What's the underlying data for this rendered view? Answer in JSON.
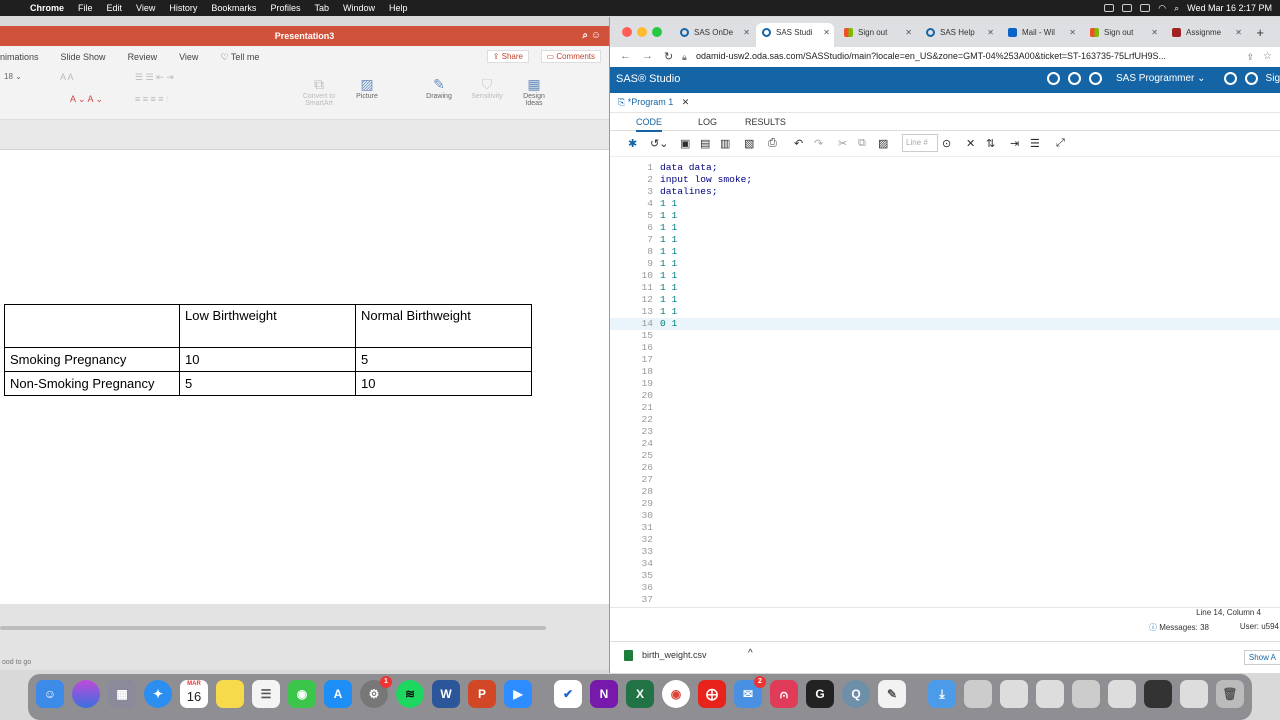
{
  "menubar": {
    "items": [
      "Chrome",
      "File",
      "Edit",
      "View",
      "History",
      "Bookmarks",
      "Profiles",
      "Tab",
      "Window",
      "Help"
    ],
    "clock": "Wed Mar 16  2:17 PM"
  },
  "ppt": {
    "title": "Presentation3",
    "tabs": [
      "nimations",
      "Slide Show",
      "Review",
      "View",
      "Tell me"
    ],
    "share_label": "Share",
    "comments_label": "Comments",
    "font_size": "18",
    "ribbon": {
      "convert": "Convert to SmartArt",
      "picture": "Picture",
      "drawing": "Drawing",
      "sensitivity": "Sensitivity",
      "design_ideas": "Design Ideas"
    },
    "status_text": "ood to go",
    "table": {
      "headers": [
        "",
        "Low Birthweight",
        "Normal Birthweight"
      ],
      "rows": [
        [
          "Smoking Pregnancy",
          "10",
          "5"
        ],
        [
          "Non-Smoking Pregnancy",
          "5",
          "10"
        ]
      ]
    }
  },
  "chrome": {
    "tabs": [
      {
        "label": "SAS OnDe",
        "color": "#1565a6"
      },
      {
        "label": "SAS Studi",
        "color": "#1565a6"
      },
      {
        "label": "Sign out",
        "color": "#f25022"
      },
      {
        "label": "SAS Help",
        "color": "#1565a6"
      },
      {
        "label": "Mail - Wil",
        "color": "#0a64c8"
      },
      {
        "label": "Sign out",
        "color": "#f25022"
      },
      {
        "label": "Assignme",
        "color": "#a02222"
      }
    ],
    "url": "odamid-usw2.oda.sas.com/SASStudio/main?locale=en_US&zone=GMT-04%253A00&ticket=ST-163735-75LrfUH9S...",
    "sas_title": "SAS® Studio",
    "sas_mode": "SAS Programmer",
    "sign_label": "Sig",
    "program_tab": "*Program 1",
    "subtabs": [
      "CODE",
      "LOG",
      "RESULTS"
    ],
    "line_placeholder": "Line #",
    "code_lines": [
      "data data;",
      "input low smoke;",
      "datalines;",
      "1 1",
      "1 1",
      "1 1",
      "1 1",
      "1 1",
      "1 1",
      "1 1",
      "1 1",
      "1 1",
      "1 1",
      "0 1"
    ],
    "total_lines": 37,
    "current_line": 14,
    "status_position": "Line 14, Column 4",
    "messages": "Messages: 38",
    "user": "User: u594",
    "download_file": "birth_weight.csv",
    "show_all": "Show A"
  },
  "dock": {
    "calendar_month": "MAR",
    "calendar_day": "16",
    "badge_settings": "1",
    "badge_mail": "2"
  }
}
